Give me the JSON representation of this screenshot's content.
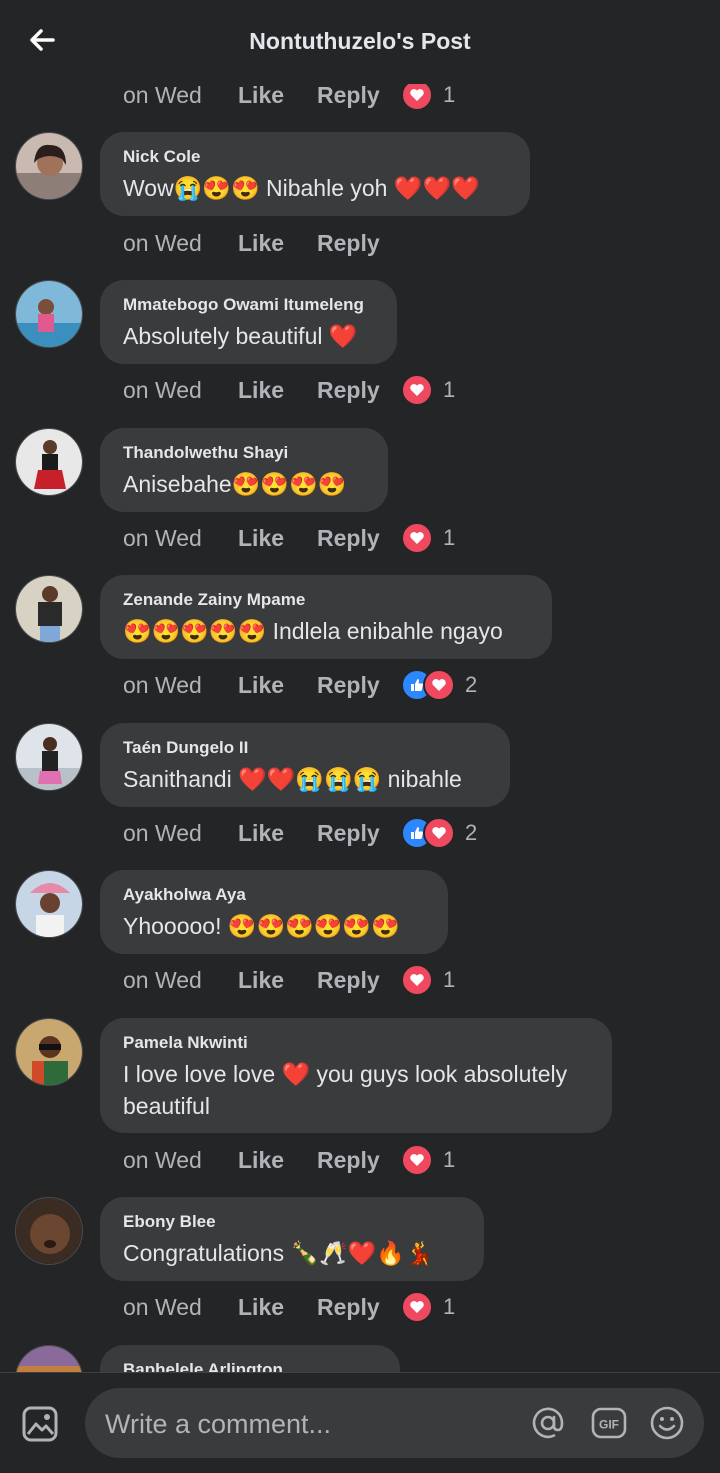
{
  "header": {
    "title": "Nontuthuzelo's Post"
  },
  "top_meta": {
    "time": "on Wed",
    "like": "Like",
    "reply": "Reply",
    "react_count": "1"
  },
  "comments": [
    {
      "author": "Nick Cole",
      "text": "Wow😭😍😍 Nibahle yoh ❤️❤️❤️",
      "time": "on Wed",
      "like": "Like",
      "reply": "Reply",
      "reactions": [],
      "react_count": ""
    },
    {
      "author": "Mmatebogo Owami Itumeleng",
      "text": "Absolutely beautiful ❤️",
      "time": "on Wed",
      "like": "Like",
      "reply": "Reply",
      "reactions": [
        "love"
      ],
      "react_count": "1"
    },
    {
      "author": "Thandolwethu Shayi",
      "text": "Anisebahe😍😍😍😍",
      "time": "on Wed",
      "like": "Like",
      "reply": "Reply",
      "reactions": [
        "love"
      ],
      "react_count": "1"
    },
    {
      "author": "Zenande Zainy Mpame",
      "text": "😍😍😍😍😍 Indlela enibahle ngayo",
      "time": "on Wed",
      "like": "Like",
      "reply": "Reply",
      "reactions": [
        "like",
        "love"
      ],
      "react_count": "2"
    },
    {
      "author": "Taén Dungelo II",
      "text": "Sanithandi ❤️❤️😭😭😭 nibahle",
      "time": "on Wed",
      "like": "Like",
      "reply": "Reply",
      "reactions": [
        "like",
        "love"
      ],
      "react_count": "2"
    },
    {
      "author": "Ayakholwa Aya",
      "text": "Yhooooo! 😍😍😍😍😍😍",
      "time": "on Wed",
      "like": "Like",
      "reply": "Reply",
      "reactions": [
        "love"
      ],
      "react_count": "1"
    },
    {
      "author": "Pamela Nkwinti",
      "text": "I love love love ❤️ you guys look absolutely beautiful",
      "time": "on Wed",
      "like": "Like",
      "reply": "Reply",
      "reactions": [
        "love"
      ],
      "react_count": "1"
    },
    {
      "author": "Ebony Blee",
      "text": "Congratulations 🍾🥂❤️🔥💃",
      "time": "on Wed",
      "like": "Like",
      "reply": "Reply",
      "reactions": [
        "love"
      ],
      "react_count": "1"
    },
    {
      "author": "Baphelele Arlington",
      "text": "",
      "time": "",
      "like": "",
      "reply": "",
      "reactions": [],
      "react_count": ""
    }
  ],
  "composer": {
    "placeholder": "Write a comment..."
  },
  "icons": {
    "back": "back-arrow-icon",
    "photo": "photo-icon",
    "mention": "mention-icon",
    "gif": "gif-icon",
    "emoji": "emoji-icon"
  },
  "colors": {
    "background": "#242527",
    "bubble": "#3a3b3c",
    "love": "#f0485f",
    "like": "#2d88ff",
    "muted": "#b0b3b8"
  }
}
